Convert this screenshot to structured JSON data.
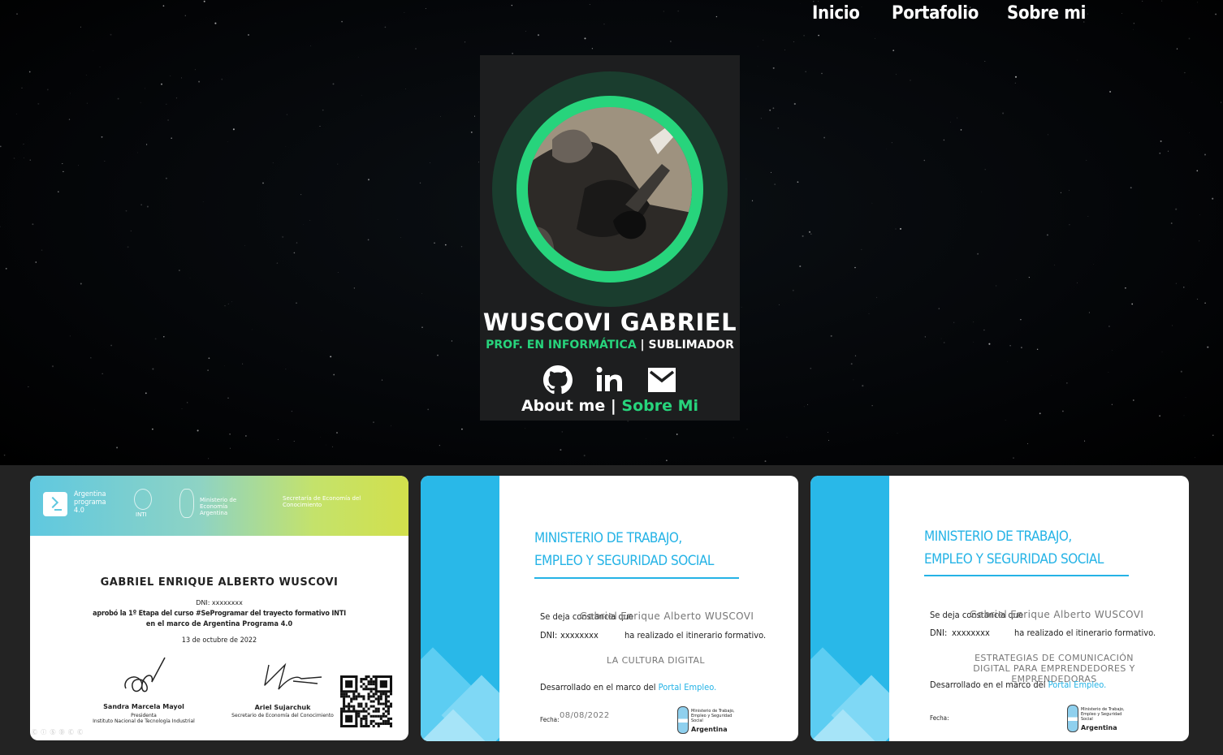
{
  "nav": {
    "items": [
      "Inicio",
      "Portafolio",
      "Sobre mi"
    ]
  },
  "profile": {
    "name": "WUSCOVI GABRIEL",
    "role_accent": "PROF. EN INFORMÁTICA",
    "separator": "|",
    "role_plain": "SUBLIMADOR",
    "social_icons": [
      "github-icon",
      "linkedin-icon",
      "email-icon"
    ],
    "about_plain": "About me",
    "about_separator": "|",
    "about_accent": "Sobre Mi",
    "accent_color": "#27d47c"
  },
  "certificates": [
    {
      "header": {
        "brand": "Argentina programa 4.0",
        "inti": "INTI",
        "ministry": "Ministerio de Economía Argentina",
        "secretary": "Secretaría de Economía del Conocimiento"
      },
      "fullname": "GABRIEL ENRIQUE ALBERTO WUSCOVI",
      "dni": "DNI:  xxxxxxxx",
      "line1": "aprobó la 1º Etapa del curso #SeProgramar del trayecto formativo INTI",
      "line2": "en el marco de Argentina Programa 4.0",
      "date": "13 de octubre de 2022",
      "signer1_name": "Sandra Marcela Mayol",
      "signer1_role_a": "Presidenta",
      "signer1_role_b": "Instituto Nacional de Tecnología Industrial",
      "signer2_name": "Ariel Sujarchuk",
      "signer2_role": "Secretario de Economía del Conocimiento",
      "license": "Ⓒ ⓘ Ⓢ Ⓓ Ⓒ Ⓒ"
    },
    {
      "ministry_line1": "MINISTERIO DE TRABAJO,",
      "ministry_line2": "EMPLEO Y SEGURIDAD SOCIAL",
      "constancia": "Se deja constancia que",
      "person": "Gabriel Enrique Alberto WUSCOVI",
      "dni_label": "DNI:",
      "dni_value": "xxxxxxxx",
      "itinerary": "ha realizado el itinerario formativo.",
      "course": "LA CULTURA DIGITAL",
      "developed": "Desarrollado en el marco del",
      "portal": "Portal Empleo.",
      "date_label": "Fecha:",
      "date_value": "08/08/2022",
      "footer_small": "Ministerio de Trabajo, Empleo y Seguridad Social",
      "footer_country": "Argentina"
    },
    {
      "ministry_line1": "MINISTERIO DE TRABAJO,",
      "ministry_line2": "EMPLEO Y SEGURIDAD SOCIAL",
      "constancia": "Se deja constancia que",
      "person": "Gabriel Enrique Alberto WUSCOVI",
      "dni_label": "DNI:",
      "dni_value": "xxxxxxxx",
      "itinerary": "ha realizado el itinerario formativo.",
      "course_line1": "ESTRATEGIAS DE COMUNICACIÓN",
      "course_line2": "DIGITAL PARA EMPRENDEDORES Y",
      "course_line3": "EMPRENDEDORAS",
      "developed": "Desarrollado en el marco del",
      "portal": "Portal Empleo.",
      "date_label": "Fecha:",
      "footer_small": "Ministerio de Trabajo, Empleo y Seguridad Social",
      "footer_country": "Argentina"
    }
  ]
}
